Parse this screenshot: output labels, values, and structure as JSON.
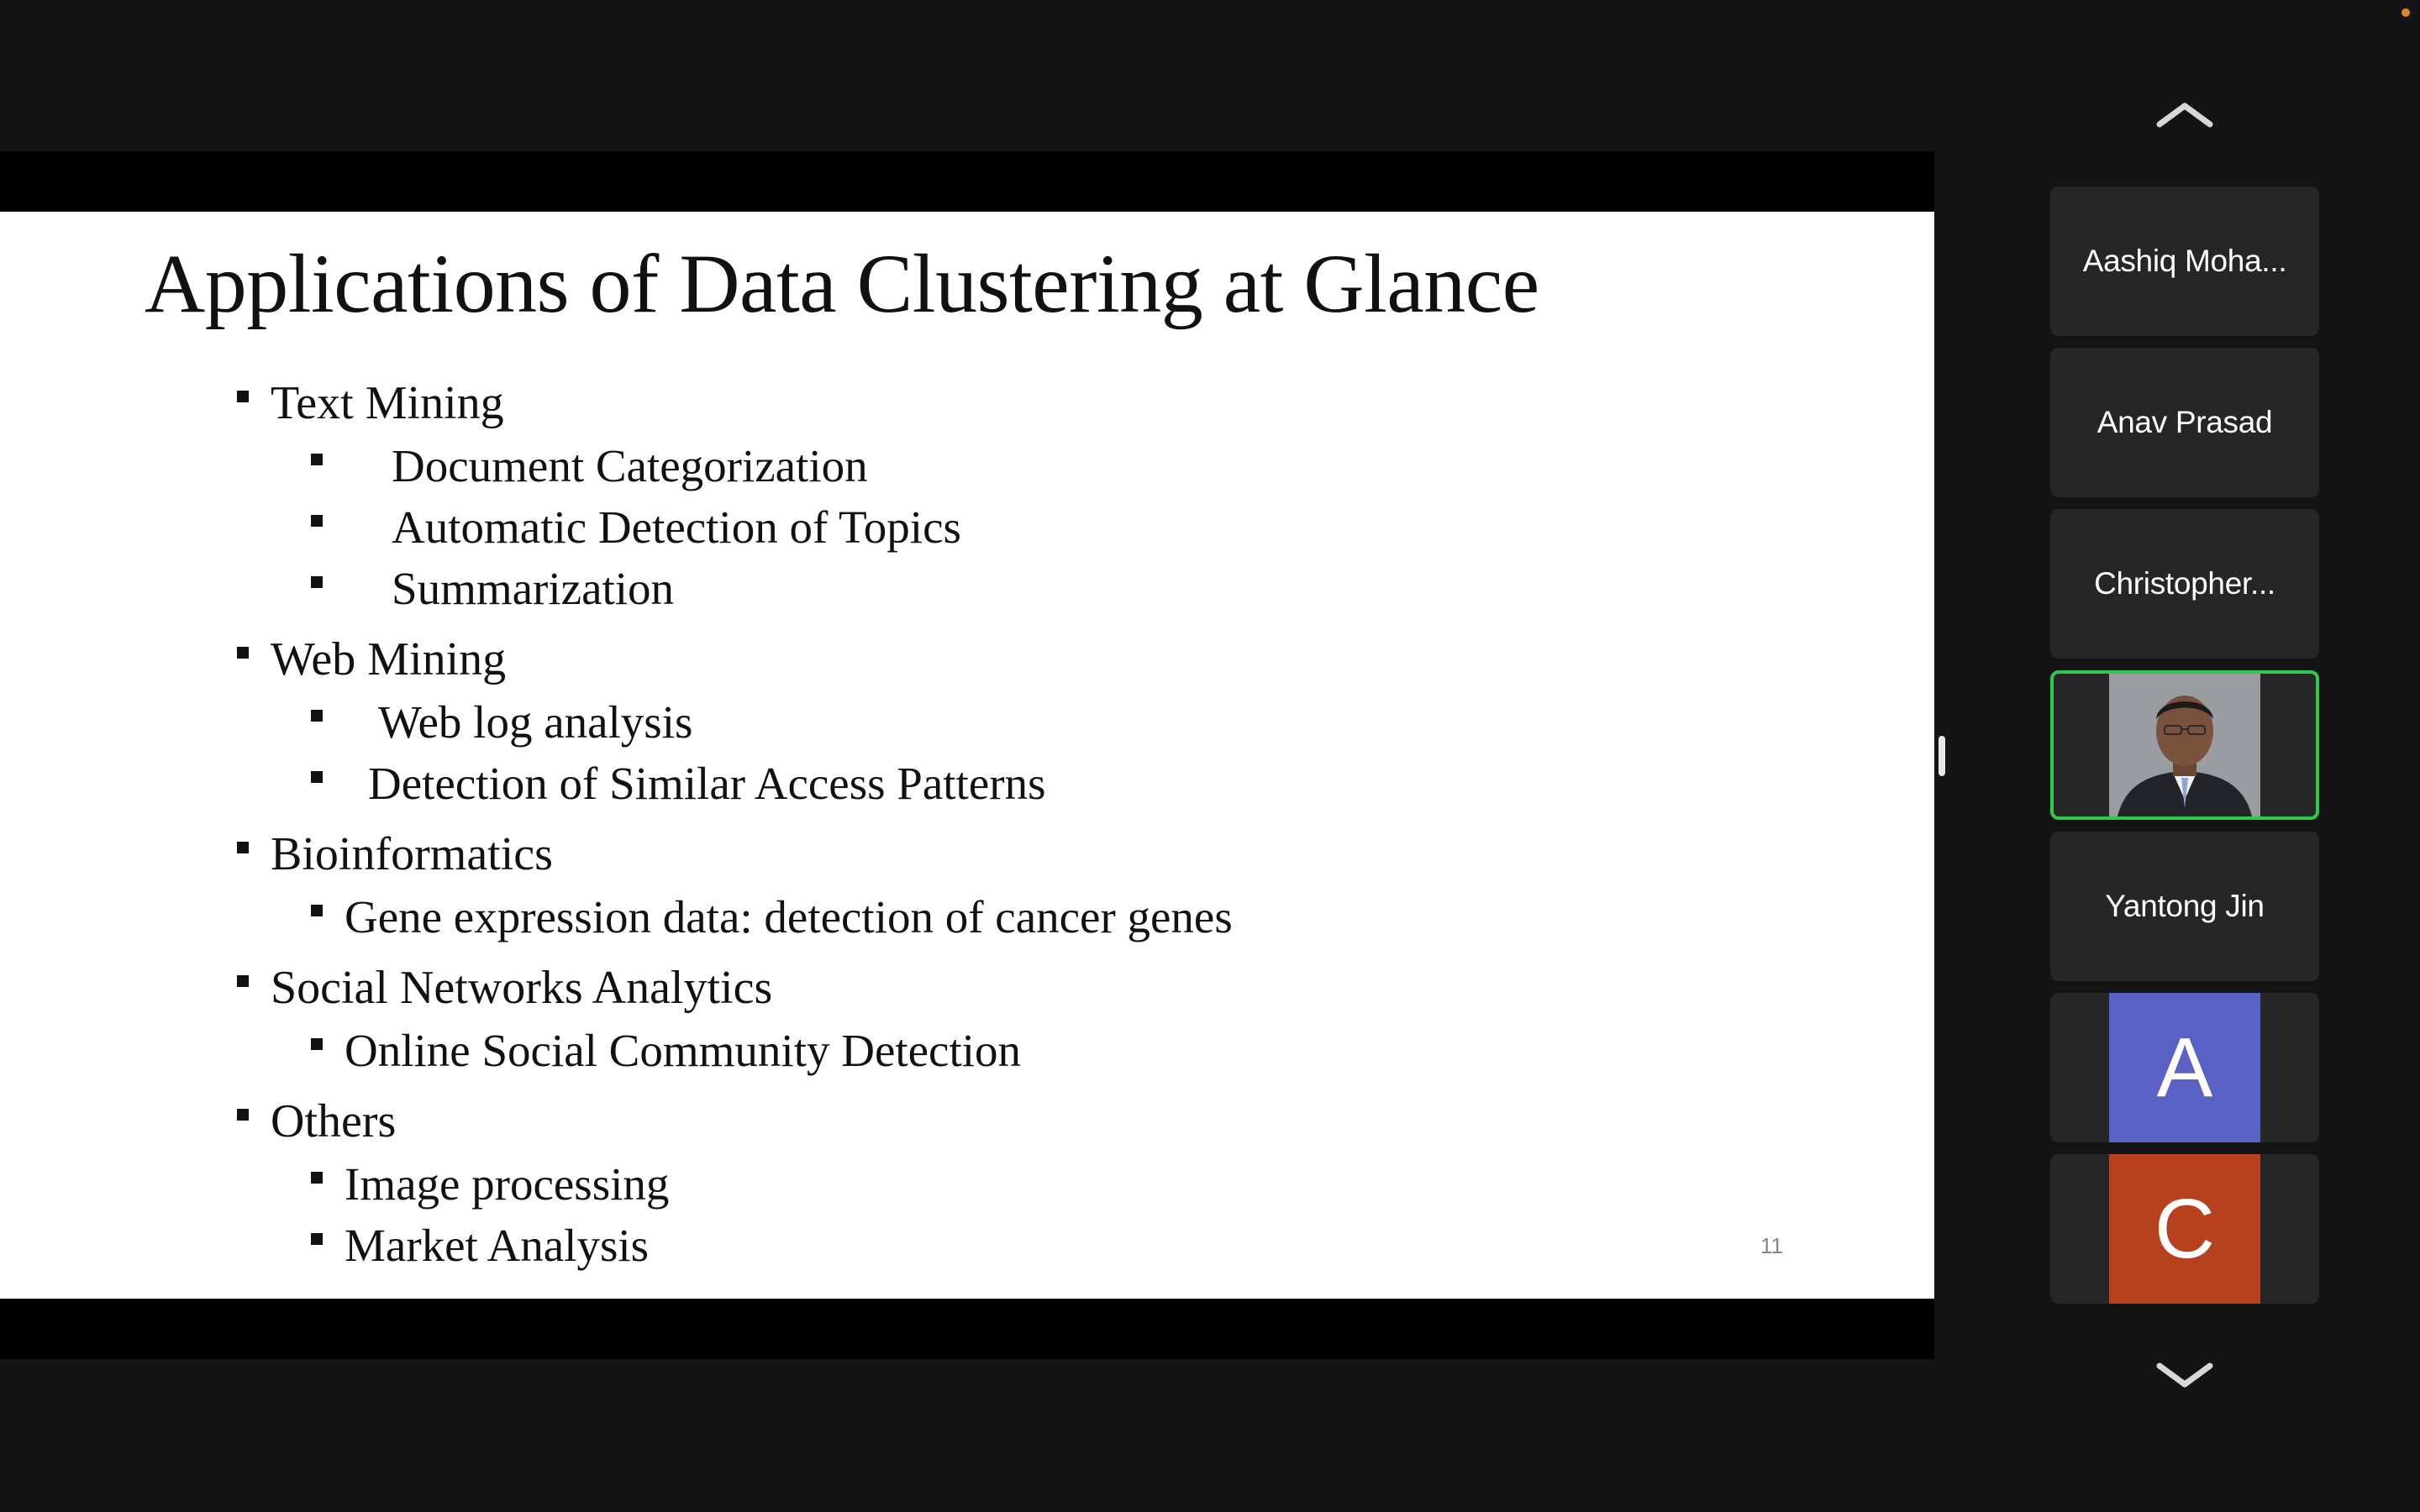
{
  "slide": {
    "title": "Applications of Data Clustering at Glance",
    "page_number": "11",
    "bullets": [
      {
        "label": "Text Mining",
        "items": [
          "Document Categorization",
          "Automatic Detection of Topics",
          "Summarization"
        ]
      },
      {
        "label": "Web Mining",
        "items": [
          "Web log analysis",
          "Detection of Similar Access Patterns"
        ]
      },
      {
        "label": "Bioinformatics",
        "items": [
          "Gene expression data: detection of cancer genes"
        ]
      },
      {
        "label": "Social Networks Analytics",
        "items": [
          "Online Social Community Detection"
        ]
      },
      {
        "label": "Others",
        "items": [
          "Image processing",
          "Market Analysis"
        ]
      }
    ]
  },
  "participants": [
    {
      "name": "Aashiq Moha..."
    },
    {
      "name": "Anav Prasad"
    },
    {
      "name": "Christopher..."
    },
    {
      "name": "",
      "video": true,
      "active": true
    },
    {
      "name": "Yantong Jin"
    },
    {
      "avatar_letter": "A",
      "avatar_color": "#5b62c5"
    },
    {
      "avatar_letter": "C",
      "avatar_color": "#b7401f"
    }
  ],
  "icons": {
    "scroll_up": "chevron-up-icon",
    "scroll_down": "chevron-down-icon"
  },
  "colors": {
    "background": "#141414",
    "tile": "#262626",
    "active_border": "#2fca4b",
    "recording_dot": "#e0862a"
  }
}
